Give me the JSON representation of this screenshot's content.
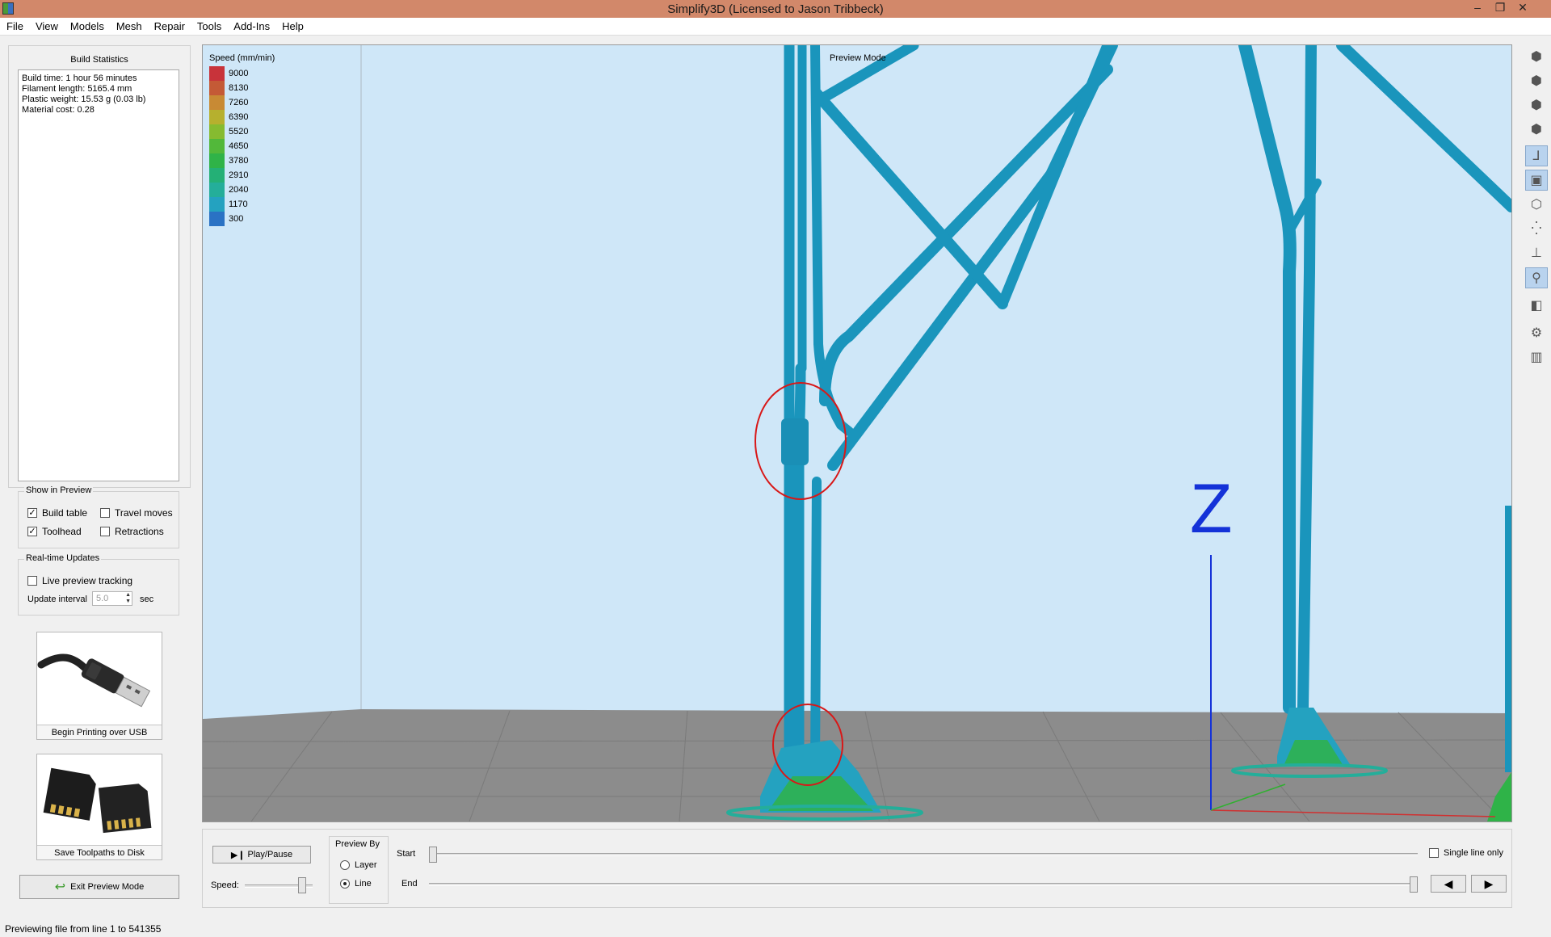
{
  "window": {
    "title": "Simplify3D (Licensed to Jason Tribbeck)",
    "minimize_glyph": "–",
    "restore_glyph": "❐",
    "close_glyph": "✕"
  },
  "menu": [
    "File",
    "View",
    "Models",
    "Mesh",
    "Repair",
    "Tools",
    "Add-Ins",
    "Help"
  ],
  "build_statistics": {
    "title": "Build Statistics",
    "lines": [
      "Build time: 1 hour 56 minutes",
      "Filament length: 5165.4 mm",
      "Plastic weight: 15.53 g (0.03 lb)",
      "Material cost: 0.28"
    ]
  },
  "show_in_preview": {
    "title": "Show in Preview",
    "build_table": {
      "label": "Build table",
      "checked": true
    },
    "travel_moves": {
      "label": "Travel moves",
      "checked": false
    },
    "toolhead": {
      "label": "Toolhead",
      "checked": true
    },
    "retractions": {
      "label": "Retractions",
      "checked": false
    }
  },
  "realtime": {
    "title": "Real-time Updates",
    "live_label": "Live preview tracking",
    "live_checked": false,
    "interval_label": "Update interval",
    "interval_value": "5.0",
    "interval_unit": "sec"
  },
  "buttons": {
    "usb": "Begin Printing over USB",
    "sd": "Save Toolpaths to Disk",
    "exit": "Exit Preview Mode",
    "play": "Play/Pause"
  },
  "legend": {
    "title": "Speed (mm/min)",
    "items": [
      {
        "value": "9000",
        "color": "#c8333a"
      },
      {
        "value": "8130",
        "color": "#c45a36"
      },
      {
        "value": "7260",
        "color": "#c88a34"
      },
      {
        "value": "6390",
        "color": "#b6b02e"
      },
      {
        "value": "5520",
        "color": "#86bb30"
      },
      {
        "value": "4650",
        "color": "#52b83a"
      },
      {
        "value": "3780",
        "color": "#2fb348"
      },
      {
        "value": "2910",
        "color": "#24b076"
      },
      {
        "value": "2040",
        "color": "#24ae9a"
      },
      {
        "value": "1170",
        "color": "#24a2c0"
      },
      {
        "value": "300",
        "color": "#2a72c4"
      }
    ]
  },
  "viewport": {
    "mode_label": "Preview Mode",
    "axis_label": "Z",
    "toolpath_color": "#1a95bc",
    "bed_color": "#8c8c8c",
    "background_color": "#cfe7f8"
  },
  "controls": {
    "speed_label": "Speed:",
    "preview_by_title": "Preview By",
    "layer_label": "Layer",
    "line_label": "Line",
    "preview_by_selected": "Line",
    "start_label": "Start",
    "end_label": "End",
    "single_line_label": "Single line only"
  },
  "status": "Previewing file from line 1 to 541355"
}
